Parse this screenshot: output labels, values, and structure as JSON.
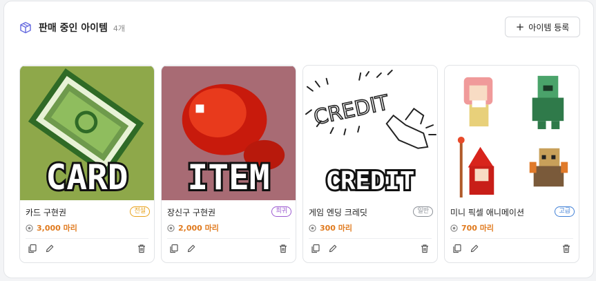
{
  "header": {
    "title": "판매 중인 아이템",
    "count": "4개",
    "add_label": "아이템 등록"
  },
  "items": [
    {
      "name": "카드 구현권",
      "badge": "전설",
      "badge_color": "#e8a11a",
      "price": "3,000 마리",
      "thumb_text": "CARD",
      "thumb_bg": "#8ea84a",
      "thumb_art": "green ticket pixel art"
    },
    {
      "name": "장신구 구현권",
      "badge": "희귀",
      "badge_color": "#9b59d0",
      "price": "2,000 마리",
      "thumb_text": "ITEM",
      "thumb_bg": "#a86b74",
      "thumb_art": "red gem pixel art"
    },
    {
      "name": "게임 엔딩 크레딧",
      "badge": "일반",
      "badge_color": "#8a8f96",
      "price": "300 마리",
      "thumb_text": "CREDIT",
      "thumb_bg": "#ffffff",
      "thumb_art": "sketch of credit scroll"
    },
    {
      "name": "미니 픽셀 애니메이션",
      "badge": "고급",
      "badge_color": "#3f7fd6",
      "price": "700 마리",
      "thumb_text": "",
      "thumb_bg": "#ffffff",
      "thumb_art": "four pixel characters"
    }
  ],
  "colors": {
    "accent_icon": "#6a6fe0",
    "price": "#e07a1e"
  },
  "icons": [
    "box-icon",
    "plus-icon",
    "coin-icon",
    "copy-icon",
    "edit-icon",
    "trash-icon"
  ]
}
